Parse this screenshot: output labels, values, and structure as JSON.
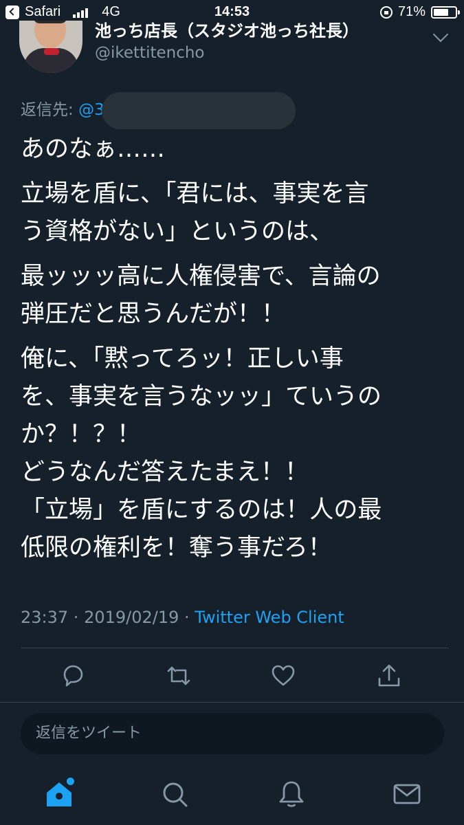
{
  "status_bar": {
    "back_app": "Safari",
    "network": "4G",
    "time": "14:53",
    "battery_percent": "71%",
    "battery_level": 0.71,
    "signal_bars": 4
  },
  "tweet": {
    "display_name": "池っち店長（スタジオ池っち社長）",
    "handle": "@ikettitencho",
    "reply_label": "返信先: ",
    "reply_mention": "@3",
    "lines": {
      "l1": "あのなぁ……",
      "l2": "立場を盾に、「君には、事実を言",
      "l3": "う資格がない」というのは、",
      "l4": "最ッッッ高に人権侵害で、言論の",
      "l5": "弾圧だと思うんだが！！",
      "l6": "俺に、「黙ってろッ！正しい事",
      "l7": "を、事実を言うなッッ」ていうの",
      "l8": "か？！？！",
      "l9": "どうなんだ答えたまえ！！",
      "l10": "「立場」を盾にするのは！人の最",
      "l11": "低限の権利を！奪う事だろ！"
    },
    "time": "23:37",
    "separator": " · ",
    "date": "2019/02/19",
    "client": "Twitter Web Client"
  },
  "actions": {
    "icons": [
      "reply-icon",
      "retweet-icon",
      "like-icon",
      "share-icon"
    ]
  },
  "reply_box": {
    "placeholder": "返信をツイート"
  },
  "tabbar": {
    "icons": [
      "home-icon",
      "search-icon",
      "notifications-icon",
      "messages-icon"
    ]
  },
  "colors": {
    "background": "#15202b",
    "accent": "#1da1f2",
    "secondary_text": "#8899a6",
    "divider": "#38444d"
  }
}
